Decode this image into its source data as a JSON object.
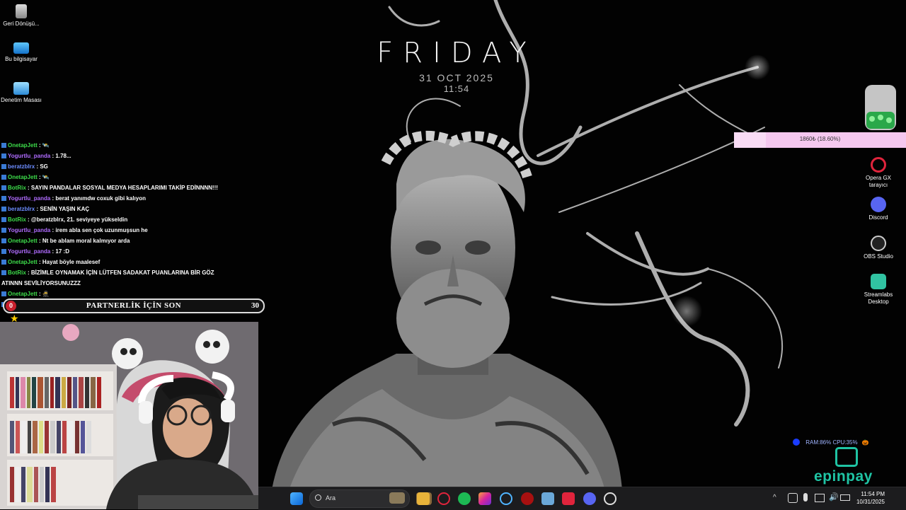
{
  "desktop_icons": [
    {
      "name": "recycle-bin",
      "label": "Geri Dönüşü..."
    },
    {
      "name": "this-pc",
      "label": "Bu bilgisayar"
    },
    {
      "name": "control-panel",
      "label": "Denetim Masası"
    }
  ],
  "right_icons": [
    {
      "name": "opera-gx",
      "label": "Opera GX tarayıcı"
    },
    {
      "name": "discord",
      "label": "Discord"
    },
    {
      "name": "obs-studio",
      "label": "OBS Studio"
    },
    {
      "name": "streamlabs",
      "label": "Streamlabs Desktop"
    }
  ],
  "clock": {
    "day": "FRIDAY",
    "date": "31 OCT 2025",
    "time": "11:54"
  },
  "chat": [
    {
      "user": "OnetapJett",
      "color": "#3ddc4a",
      "msg": "🛰️"
    },
    {
      "user": "Yogurtlu_panda",
      "color": "#b06cff",
      "msg": "1.78..."
    },
    {
      "user": "beratzblrx",
      "color": "#6c8cff",
      "msg": "SG"
    },
    {
      "user": "OnetapJett",
      "color": "#3ddc4a",
      "msg": "🛰️"
    },
    {
      "user": "BotRix",
      "color": "#3ddc4a",
      "msg": "SAYIN PANDALAR SOSYAL MEDYA HESAPLARIMI TAKİP EDİNNNN!!!"
    },
    {
      "user": "Yogurtlu_panda",
      "color": "#b06cff",
      "msg": "berat yanımdw coxuk gibi kalıyon"
    },
    {
      "user": "beratzblrx",
      "color": "#6c8cff",
      "msg": "SENİN YAŞIN KAÇ"
    },
    {
      "user": "BotRix",
      "color": "#3ddc4a",
      "msg": "@beratzblrx, 21. seviyeye yükseldin"
    },
    {
      "user": "Yogurtlu_panda",
      "color": "#b06cff",
      "msg": "irem abla sen çok uzunmuşsun he"
    },
    {
      "user": "OnetapJett",
      "color": "#3ddc4a",
      "msg": "Nt be ablam moral kalmıyor arda"
    },
    {
      "user": "Yogurtlu_panda",
      "color": "#b06cff",
      "msg": "17 :D"
    },
    {
      "user": "OnetapJett",
      "color": "#3ddc4a",
      "msg": "Hayat böyle maalesef"
    },
    {
      "user": "BotRix",
      "color": "#3ddc4a",
      "msg": "BİZİMLE OYNAMAK İÇİN LÜTFEN SADAKAT PUANLARINA BİR GÖZ"
    },
    {
      "user": "",
      "color": "#fff",
      "msg": "ATINNN SEVİLİYORSUNUZZZ"
    },
    {
      "user": "OnetapJett",
      "color": "#3ddc4a",
      "msg": "🥷"
    },
    {
      "user": "OnetapJett",
      "color": "#3ddc4a",
      "msg": "🛰️"
    }
  ],
  "partner_bar": {
    "left_num": "0",
    "label": "PARTNERLİK İÇİN SON",
    "right_num": "30"
  },
  "goal": {
    "text": "1860₺ (18.60%)",
    "fraction": 0.186
  },
  "sysinfo": "RAM:86% CPU:35%",
  "epinpay": "epinpay",
  "taskbar": {
    "search_placeholder": "Ara",
    "time": "11:54 PM",
    "date": "10/31/2025"
  },
  "colors": {
    "accent": "#1fc4a4",
    "goal_bg": "#f5c8ef"
  }
}
